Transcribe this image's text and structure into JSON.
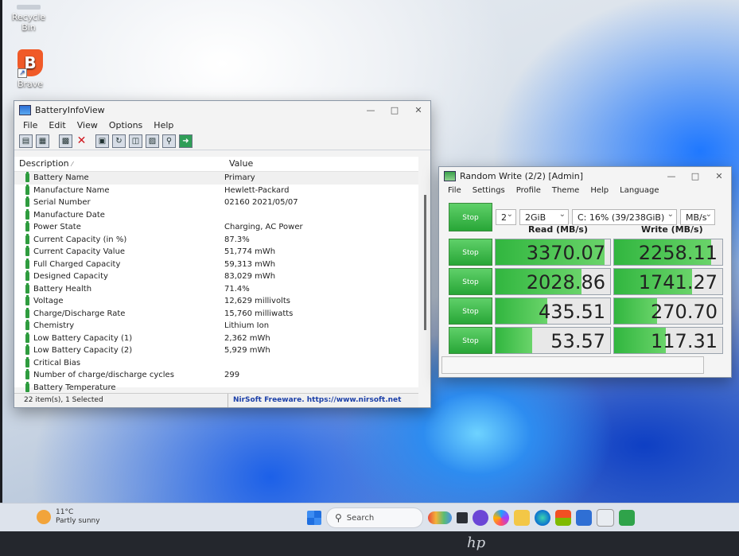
{
  "desktop": {
    "icons": [
      {
        "label": "Recycle Bin"
      },
      {
        "label": "Brave",
        "glyph": "B"
      }
    ]
  },
  "battery_window": {
    "title": "BatteryInfoView",
    "menu": [
      "File",
      "Edit",
      "View",
      "Options",
      "Help"
    ],
    "toolbar_icons": [
      "properties-icon",
      "copy-icon",
      "grid-icon",
      "delete-icon",
      "save-icon",
      "refresh-icon",
      "copy-all-icon",
      "html-report-icon",
      "find-icon",
      "exit-icon"
    ],
    "columns": [
      "Description",
      "Value"
    ],
    "rows": [
      {
        "description": "Battery Name",
        "value": "Primary"
      },
      {
        "description": "Manufacture Name",
        "value": "Hewlett-Packard"
      },
      {
        "description": "Serial Number",
        "value": "02160 2021/05/07"
      },
      {
        "description": "Manufacture Date",
        "value": ""
      },
      {
        "description": "Power State",
        "value": "Charging, AC Power"
      },
      {
        "description": "Current Capacity (in %)",
        "value": "87.3%"
      },
      {
        "description": "Current Capacity Value",
        "value": "51,774 mWh"
      },
      {
        "description": "Full Charged Capacity",
        "value": "59,313 mWh"
      },
      {
        "description": "Designed Capacity",
        "value": "83,029 mWh"
      },
      {
        "description": "Battery Health",
        "value": "71.4%"
      },
      {
        "description": "Voltage",
        "value": "12,629 millivolts"
      },
      {
        "description": "Charge/Discharge Rate",
        "value": "15,760 milliwatts"
      },
      {
        "description": "Chemistry",
        "value": "Lithium Ion"
      },
      {
        "description": "Low Battery Capacity (1)",
        "value": "2,362 mWh"
      },
      {
        "description": "Low Battery Capacity (2)",
        "value": "5,929 mWh"
      },
      {
        "description": "Critical Bias",
        "value": ""
      },
      {
        "description": "Number of charge/discharge cycles",
        "value": "299"
      },
      {
        "description": "Battery Temperature",
        "value": ""
      }
    ],
    "status_count": "22 item(s), 1 Selected",
    "status_credit": "NirSoft Freeware. https://www.nirsoft.net"
  },
  "cdm_window": {
    "title": "Random Write (2/2) [Admin]",
    "menu": [
      "File",
      "Settings",
      "Profile",
      "Theme",
      "Help",
      "Language"
    ],
    "all_button": "Stop",
    "count": "2",
    "size": "2GiB",
    "drive": "C: 16% (39/238GiB)",
    "unit": "MB/s",
    "read_header": "Read (MB/s)",
    "write_header": "Write (MB/s)",
    "results": [
      {
        "button": "Stop",
        "read": "3370.07",
        "write": "2258.11",
        "read_fill": 0.95,
        "write_fill": 0.9
      },
      {
        "button": "Stop",
        "read": "2028.86",
        "write": "1741.27",
        "read_fill": 0.75,
        "write_fill": 0.72
      },
      {
        "button": "Stop",
        "read": "435.51",
        "write": "270.70",
        "read_fill": 0.45,
        "write_fill": 0.4
      },
      {
        "button": "Stop",
        "read": "53.57",
        "write": "117.31",
        "read_fill": 0.32,
        "write_fill": 0.48
      }
    ]
  },
  "taskbar": {
    "weather_temp": "11°C",
    "weather_desc": "Partly sunny",
    "search_label": "Search"
  },
  "bezel": {
    "brand": "hp"
  }
}
